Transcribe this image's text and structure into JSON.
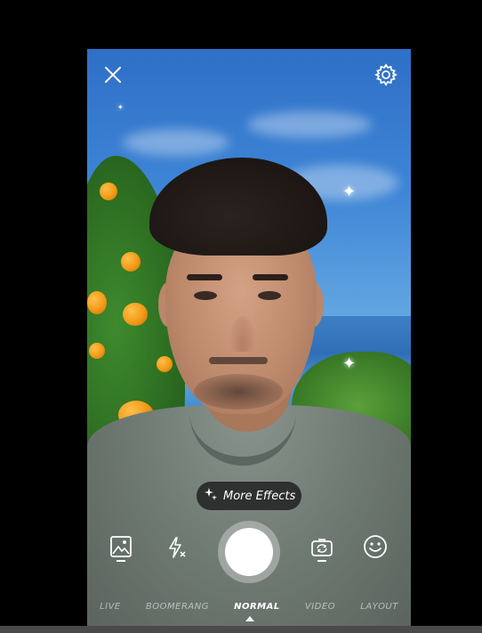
{
  "camera": {
    "close_icon": "close-icon",
    "settings_icon": "gear-icon",
    "effects_label": "More Effects",
    "bottom_icons": [
      "gallery-icon",
      "flash-off-icon",
      "shutter-button",
      "switch-camera-icon",
      "emoji-icon"
    ],
    "modes": [
      "LIVE",
      "BOOMERANG",
      "NORMAL",
      "VIDEO",
      "LAYOUT"
    ],
    "active_mode": "NORMAL"
  }
}
